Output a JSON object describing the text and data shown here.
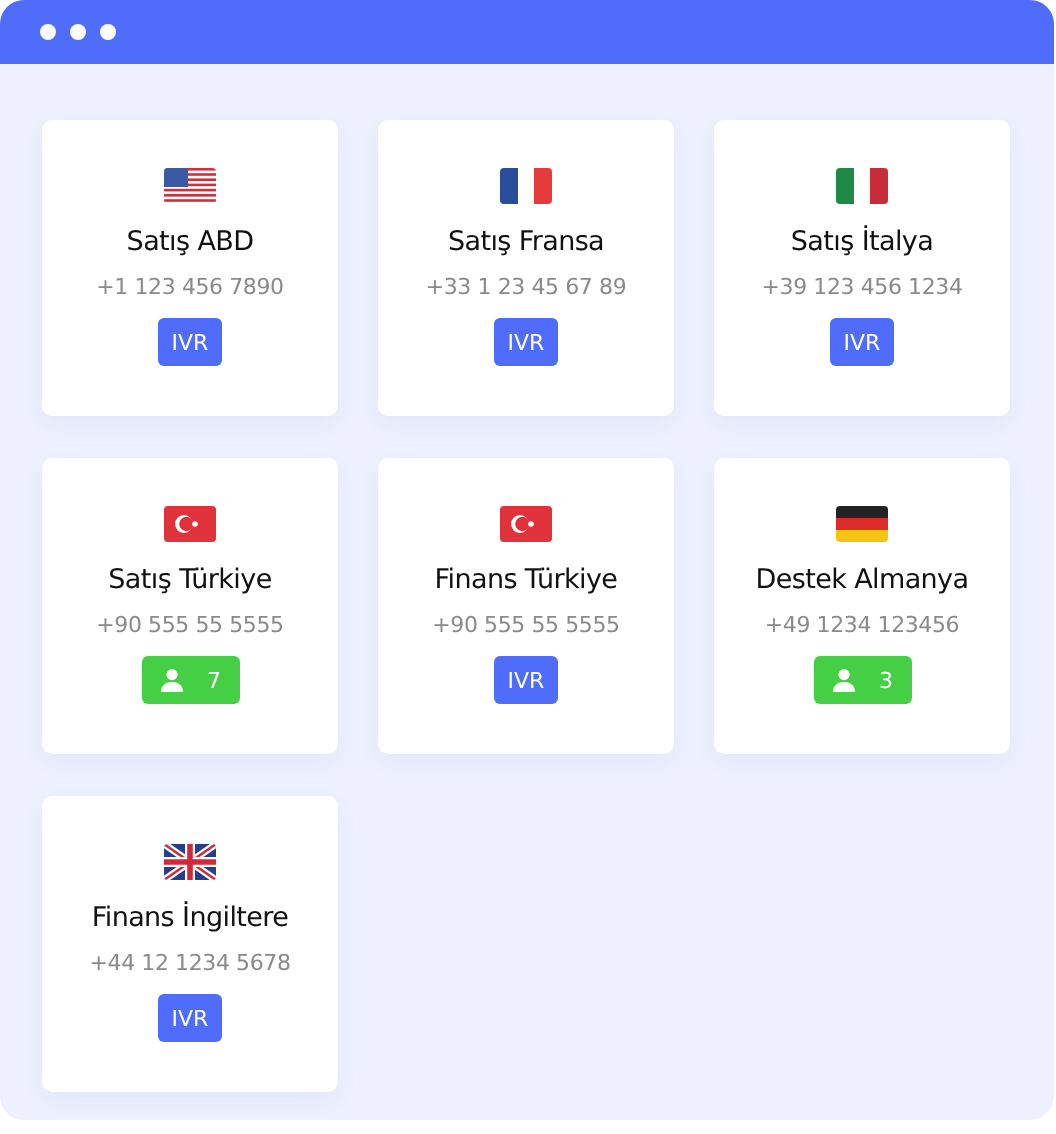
{
  "cards": [
    {
      "flag": {
        "kind": "us"
      },
      "name": "Satış ABD",
      "phone": "+1 123 456 7890",
      "badge": {
        "kind": "ivr",
        "text": "IVR"
      }
    },
    {
      "flag": {
        "kind": "fr"
      },
      "name": "Satış Fransa",
      "phone": "+33 1 23 45 67 89",
      "badge": {
        "kind": "ivr",
        "text": "IVR"
      }
    },
    {
      "flag": {
        "kind": "it"
      },
      "name": "Satış İtalya",
      "phone": "+39 123 456 1234",
      "badge": {
        "kind": "ivr",
        "text": "IVR"
      }
    },
    {
      "flag": {
        "kind": "tr"
      },
      "name": "Satış Türkiye",
      "phone": "+90 555 55 5555",
      "badge": {
        "kind": "agents",
        "text": "7"
      }
    },
    {
      "flag": {
        "kind": "tr"
      },
      "name": "Finans Türkiye",
      "phone": "+90 555 55 5555",
      "badge": {
        "kind": "ivr",
        "text": "IVR"
      }
    },
    {
      "flag": {
        "kind": "de"
      },
      "name": "Destek Almanya",
      "phone": "+49 1234 123456",
      "badge": {
        "kind": "agents",
        "text": "3"
      }
    },
    {
      "flag": {
        "kind": "gb"
      },
      "name": "Finans İngiltere",
      "phone": "+44 12 1234 5678",
      "badge": {
        "kind": "ivr",
        "text": "IVR"
      }
    }
  ]
}
